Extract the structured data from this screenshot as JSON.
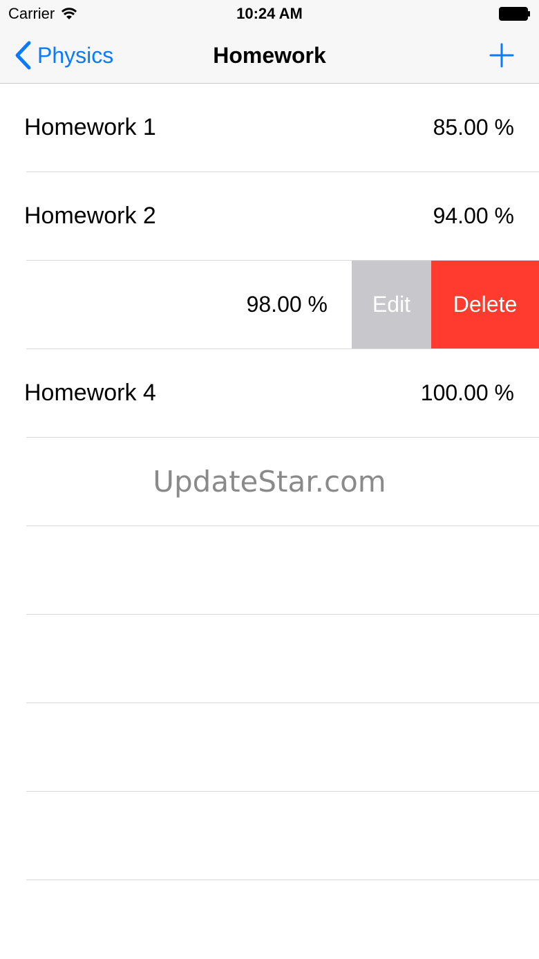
{
  "status_bar": {
    "carrier": "Carrier",
    "time": "10:24 AM"
  },
  "nav": {
    "back_label": "Physics",
    "title": "Homework"
  },
  "rows": [
    {
      "title": "Homework 1",
      "value": "85.00 %"
    },
    {
      "title": "Homework 2",
      "value": "94.00 %"
    },
    {
      "title": "",
      "value": "98.00 %"
    },
    {
      "title": "Homework 4",
      "value": "100.00 %"
    }
  ],
  "swipe_actions": {
    "edit_label": "Edit",
    "delete_label": "Delete"
  },
  "watermark": "UpdateStar.com",
  "colors": {
    "accent": "#0a7aff",
    "delete": "#ff3b30",
    "edit": "#c7c7cc"
  }
}
